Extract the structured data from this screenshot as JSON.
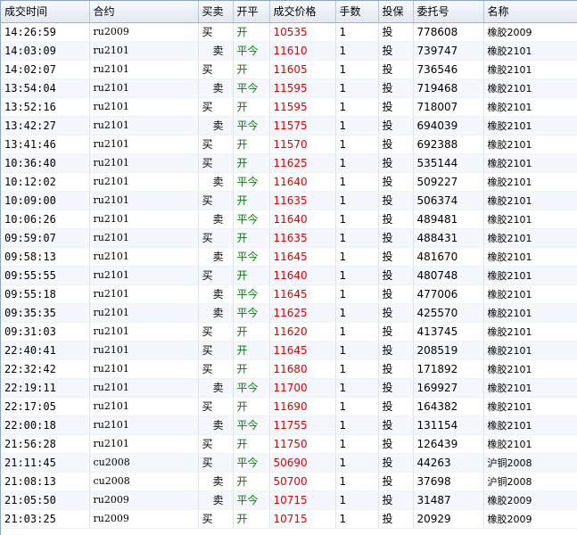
{
  "columns": [
    "成交时间",
    "合约",
    "买卖",
    "开平",
    "成交价格",
    "手数",
    "投保",
    "委托号",
    "名称"
  ],
  "rows": [
    {
      "time": "14:26:59",
      "contract": "ru2009",
      "side": "买",
      "oc": "开",
      "price": "10535",
      "qty": "1",
      "hedge": "投",
      "order": "778608",
      "name": "橡胶2009"
    },
    {
      "time": "14:03:09",
      "contract": "ru2101",
      "side": "卖",
      "oc": "平今",
      "price": "11610",
      "qty": "1",
      "hedge": "投",
      "order": "739747",
      "name": "橡胶2101"
    },
    {
      "time": "14:02:07",
      "contract": "ru2101",
      "side": "买",
      "oc": "开",
      "price": "11605",
      "qty": "1",
      "hedge": "投",
      "order": "736546",
      "name": "橡胶2101"
    },
    {
      "time": "13:54:04",
      "contract": "ru2101",
      "side": "卖",
      "oc": "平今",
      "price": "11595",
      "qty": "1",
      "hedge": "投",
      "order": "719468",
      "name": "橡胶2101"
    },
    {
      "time": "13:52:16",
      "contract": "ru2101",
      "side": "买",
      "oc": "开",
      "price": "11595",
      "qty": "1",
      "hedge": "投",
      "order": "718007",
      "name": "橡胶2101"
    },
    {
      "time": "13:42:27",
      "contract": "ru2101",
      "side": "卖",
      "oc": "平今",
      "price": "11575",
      "qty": "1",
      "hedge": "投",
      "order": "694039",
      "name": "橡胶2101"
    },
    {
      "time": "13:41:46",
      "contract": "ru2101",
      "side": "买",
      "oc": "开",
      "price": "11570",
      "qty": "1",
      "hedge": "投",
      "order": "692388",
      "name": "橡胶2101"
    },
    {
      "time": "10:36:40",
      "contract": "ru2101",
      "side": "买",
      "oc": "开",
      "price": "11625",
      "qty": "1",
      "hedge": "投",
      "order": "535144",
      "name": "橡胶2101"
    },
    {
      "time": "10:12:02",
      "contract": "ru2101",
      "side": "卖",
      "oc": "平今",
      "price": "11640",
      "qty": "1",
      "hedge": "投",
      "order": "509227",
      "name": "橡胶2101"
    },
    {
      "time": "10:09:00",
      "contract": "ru2101",
      "side": "买",
      "oc": "开",
      "price": "11635",
      "qty": "1",
      "hedge": "投",
      "order": "506374",
      "name": "橡胶2101"
    },
    {
      "time": "10:06:26",
      "contract": "ru2101",
      "side": "卖",
      "oc": "平今",
      "price": "11640",
      "qty": "1",
      "hedge": "投",
      "order": "489481",
      "name": "橡胶2101"
    },
    {
      "time": "09:59:07",
      "contract": "ru2101",
      "side": "买",
      "oc": "开",
      "price": "11635",
      "qty": "1",
      "hedge": "投",
      "order": "488431",
      "name": "橡胶2101"
    },
    {
      "time": "09:58:13",
      "contract": "ru2101",
      "side": "卖",
      "oc": "平今",
      "price": "11645",
      "qty": "1",
      "hedge": "投",
      "order": "481670",
      "name": "橡胶2101"
    },
    {
      "time": "09:55:55",
      "contract": "ru2101",
      "side": "买",
      "oc": "开",
      "price": "11640",
      "qty": "1",
      "hedge": "投",
      "order": "480748",
      "name": "橡胶2101"
    },
    {
      "time": "09:55:18",
      "contract": "ru2101",
      "side": "卖",
      "oc": "平今",
      "price": "11645",
      "qty": "1",
      "hedge": "投",
      "order": "477006",
      "name": "橡胶2101"
    },
    {
      "time": "09:35:35",
      "contract": "ru2101",
      "side": "卖",
      "oc": "平今",
      "price": "11625",
      "qty": "1",
      "hedge": "投",
      "order": "425570",
      "name": "橡胶2101"
    },
    {
      "time": "09:31:03",
      "contract": "ru2101",
      "side": "买",
      "oc": "开",
      "price": "11620",
      "qty": "1",
      "hedge": "投",
      "order": "413745",
      "name": "橡胶2101"
    },
    {
      "time": "22:40:41",
      "contract": "ru2101",
      "side": "买",
      "oc": "开",
      "price": "11645",
      "qty": "1",
      "hedge": "投",
      "order": "208519",
      "name": "橡胶2101"
    },
    {
      "time": "22:32:42",
      "contract": "ru2101",
      "side": "买",
      "oc": "开",
      "price": "11680",
      "qty": "1",
      "hedge": "投",
      "order": "171892",
      "name": "橡胶2101"
    },
    {
      "time": "22:19:11",
      "contract": "ru2101",
      "side": "卖",
      "oc": "平今",
      "price": "11700",
      "qty": "1",
      "hedge": "投",
      "order": "169927",
      "name": "橡胶2101"
    },
    {
      "time": "22:17:05",
      "contract": "ru2101",
      "side": "买",
      "oc": "开",
      "price": "11690",
      "qty": "1",
      "hedge": "投",
      "order": "164382",
      "name": "橡胶2101"
    },
    {
      "time": "22:00:18",
      "contract": "ru2101",
      "side": "卖",
      "oc": "平今",
      "price": "11755",
      "qty": "1",
      "hedge": "投",
      "order": "131154",
      "name": "橡胶2101"
    },
    {
      "time": "21:56:28",
      "contract": "ru2101",
      "side": "买",
      "oc": "开",
      "price": "11750",
      "qty": "1",
      "hedge": "投",
      "order": "126439",
      "name": "橡胶2101"
    },
    {
      "time": "21:11:45",
      "contract": "cu2008",
      "side": "买",
      "oc": "平今",
      "price": "50690",
      "qty": "1",
      "hedge": "投",
      "order": "44263",
      "name": "沪铜2008"
    },
    {
      "time": "21:08:13",
      "contract": "cu2008",
      "side": "卖",
      "oc": "开",
      "price": "50700",
      "qty": "1",
      "hedge": "投",
      "order": "37698",
      "name": "沪铜2008"
    },
    {
      "time": "21:05:50",
      "contract": "ru2009",
      "side": "卖",
      "oc": "平今",
      "price": "10715",
      "qty": "1",
      "hedge": "投",
      "order": "31487",
      "name": "橡胶2009"
    },
    {
      "time": "21:03:25",
      "contract": "ru2009",
      "side": "买",
      "oc": "开",
      "price": "10715",
      "qty": "1",
      "hedge": "投",
      "order": "20929",
      "name": "橡胶2009"
    }
  ]
}
